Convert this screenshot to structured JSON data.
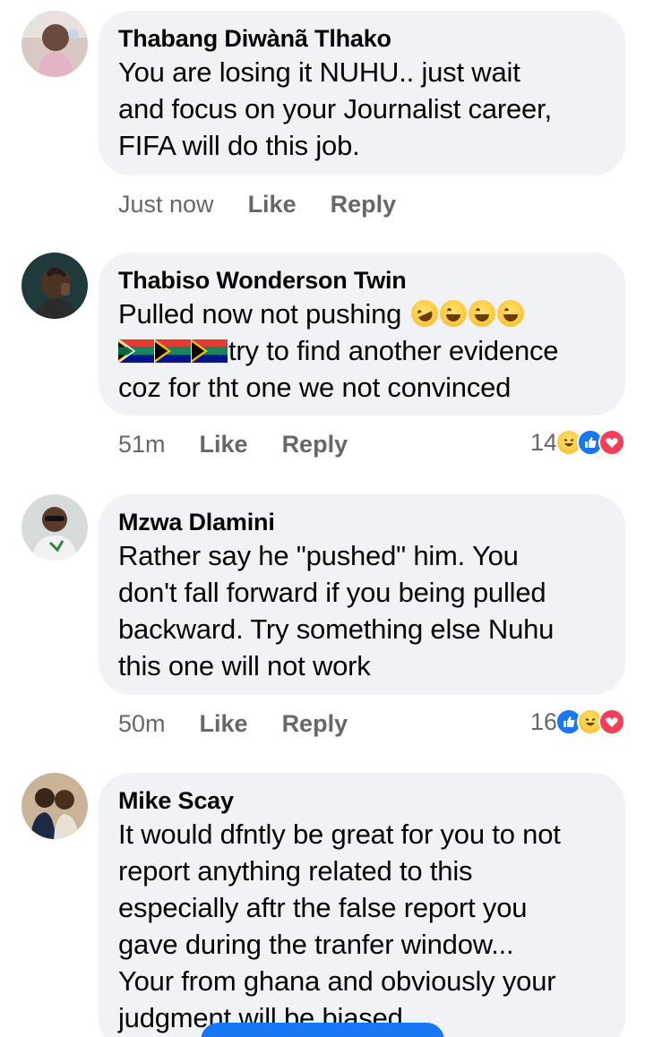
{
  "comments": [
    {
      "author": "Thabang Diwànã Tlhako",
      "lines": [
        "You are losing it NUHU.. just wait",
        "and focus on your Journalist career,",
        "FIFA will do this job."
      ],
      "time": "Just now",
      "like": "Like",
      "reply": "Reply",
      "avatar_icon": "avatar-child-photo",
      "reaction_count": null,
      "reactions": []
    },
    {
      "author": "Thabiso Wonderson Twin",
      "lines": [
        "Pulled now not pushing",
        "try to find another evidence",
        "coz for tht one we not convinced"
      ],
      "emojis_line1": [
        "rolling-laughing-emoji",
        "tears-of-joy-emoji",
        "tears-of-joy-emoji",
        "tears-of-joy-emoji"
      ],
      "flags_line2": [
        "south-africa-flag",
        "south-africa-flag",
        "south-africa-flag"
      ],
      "time": "51m",
      "like": "Like",
      "reply": "Reply",
      "avatar_icon": "avatar-man-photo",
      "reaction_count": "14",
      "reactions": [
        "haha-reaction-icon",
        "like-reaction-icon",
        "love-reaction-icon"
      ]
    },
    {
      "author": "Mzwa Dlamini",
      "lines": [
        "Rather say he \"pushed\" him. You",
        "don't fall forward if you being pulled",
        "backward. Try something else Nuhu",
        "this one will not work"
      ],
      "time": "50m",
      "like": "Like",
      "reply": "Reply",
      "avatar_icon": "avatar-man-sunglasses-photo",
      "reaction_count": "16",
      "reactions": [
        "like-reaction-icon",
        "haha-reaction-icon",
        "love-reaction-icon"
      ]
    },
    {
      "author": "Mike Scay",
      "lines": [
        "It would dfntly be great for you to not",
        "report anything related to this",
        "especially aftr the false report you",
        "gave during the tranfer window...",
        "Your from ghana and obviously your",
        "judgment will be biased"
      ],
      "avatar_icon": "avatar-couple-photo"
    }
  ],
  "colors": {
    "bubble": "#f0f2f5",
    "meta": "#65676b",
    "like_blue": "#1877f2",
    "love_red": "#f33e58",
    "haha_yellow": "#f7b928"
  }
}
